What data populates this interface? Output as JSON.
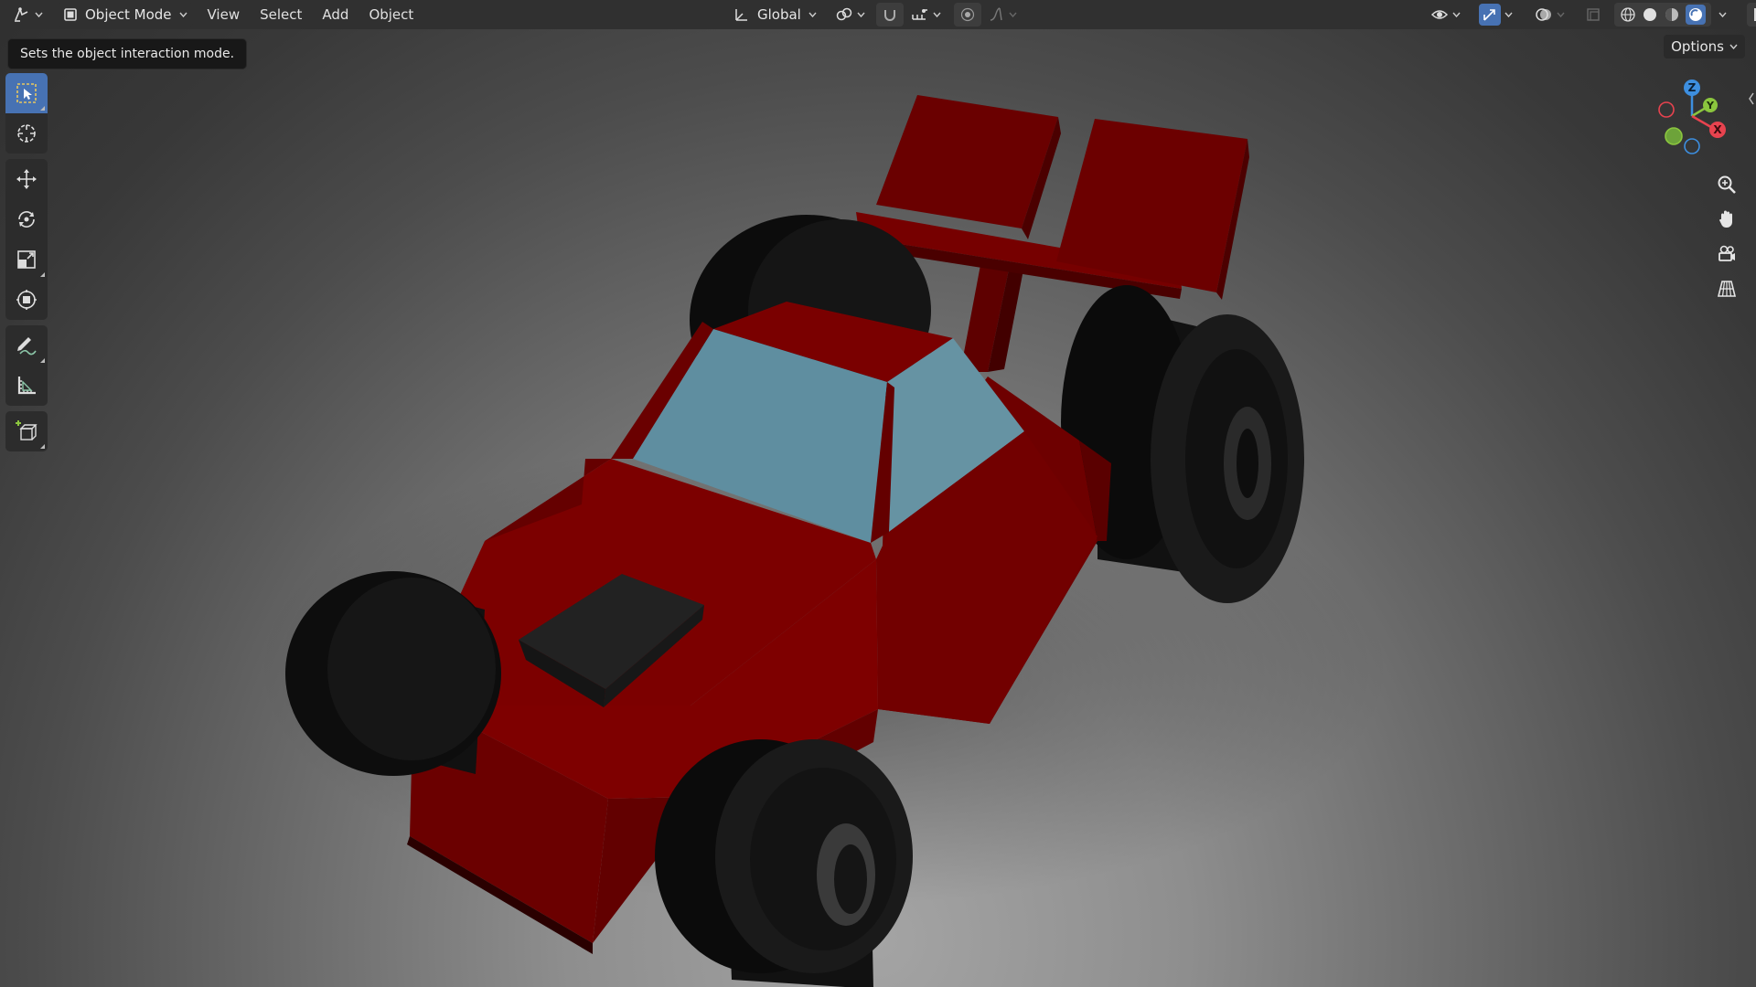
{
  "header": {
    "mode_label": "Object Mode",
    "menus": [
      "View",
      "Select",
      "Add",
      "Object"
    ],
    "transform_orientation": "Global"
  },
  "tooltip": {
    "text": "Sets the object interaction mode."
  },
  "toolbar": {
    "tools": [
      {
        "name": "select-box-tool",
        "icon": "select-box-icon",
        "active": true
      },
      {
        "name": "cursor-tool",
        "icon": "cursor-crosshair-icon"
      },
      {
        "name": "move-tool",
        "icon": "move-arrows-icon"
      },
      {
        "name": "rotate-tool",
        "icon": "rotate-icon"
      },
      {
        "name": "scale-tool",
        "icon": "scale-icon"
      },
      {
        "name": "transform-tool",
        "icon": "transform-icon"
      },
      {
        "name": "annotate-tool",
        "icon": "pencil-icon"
      },
      {
        "name": "measure-tool",
        "icon": "ruler-icon"
      },
      {
        "name": "add-cube-tool",
        "icon": "add-cube-icon"
      }
    ]
  },
  "right_panel": {
    "options_label": "Options",
    "gizmo": {
      "x": "X",
      "y": "Y",
      "z": "Z"
    }
  },
  "colors": {
    "accent": "#4772b3",
    "header_bg": "#303030",
    "axis_x": "#e8434f",
    "axis_y": "#8bc63e",
    "axis_z": "#3d8fe0",
    "car_body": "#7d0000",
    "car_glass": "#5e8d9e",
    "tire": "#111111"
  }
}
